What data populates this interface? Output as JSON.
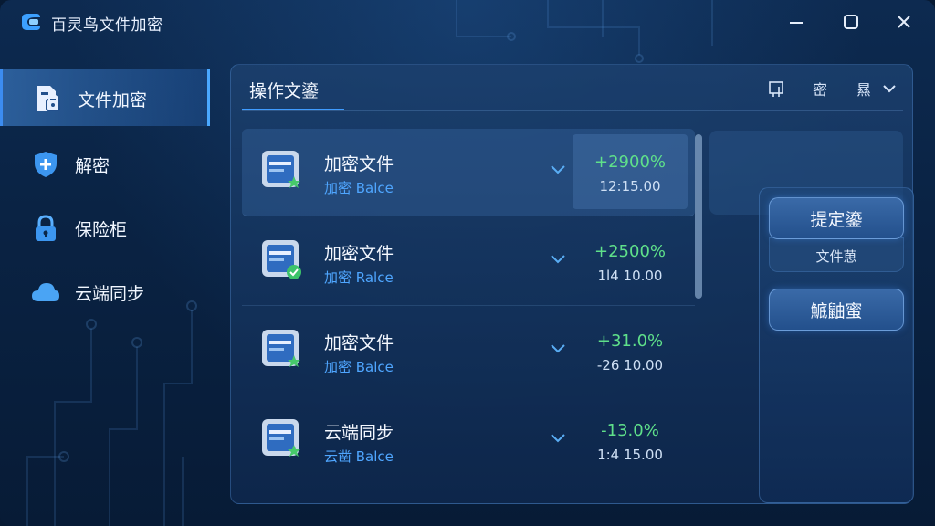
{
  "window": {
    "title": "百灵鸟文件加密"
  },
  "sidebar": {
    "items": [
      {
        "label": "文件加密",
        "icon": "file-lock-icon",
        "active": true
      },
      {
        "label": "解密",
        "icon": "shield-plus-icon",
        "active": false
      },
      {
        "label": "保险柜",
        "icon": "padlock-icon",
        "active": false
      },
      {
        "label": "云端同步",
        "icon": "cloud-icon",
        "active": false
      }
    ]
  },
  "panel": {
    "tab": "操作文鎏",
    "tools": {
      "tool1": "⊡",
      "tool2": "密",
      "tool3": "㬎"
    },
    "rows": [
      {
        "name": "加密文件",
        "sub": "加密 Balce",
        "pct": "+2900%",
        "val": "12:15.00",
        "badge": "star"
      },
      {
        "name": "加密文件",
        "sub": "加密 Ralce",
        "pct": "+2500%",
        "val": "1l4 10.00",
        "badge": "check"
      },
      {
        "name": "加密文件",
        "sub": "加密 Balce",
        "pct": "+31.0%",
        "val": "-26 10.00",
        "badge": "star"
      },
      {
        "name": "云端同步",
        "sub": "云凿 Balce",
        "pct": "-13.0%",
        "val": "1:4 15.00",
        "badge": "star"
      }
    ]
  },
  "side_panel": {
    "btn1": "提定鎏",
    "btn1_sub": "文件葸",
    "btn2": "鯳鼬蜜"
  },
  "colors": {
    "accent": "#3f9cff",
    "positive": "#5fe08a",
    "sub_text": "#4fa6ff"
  }
}
